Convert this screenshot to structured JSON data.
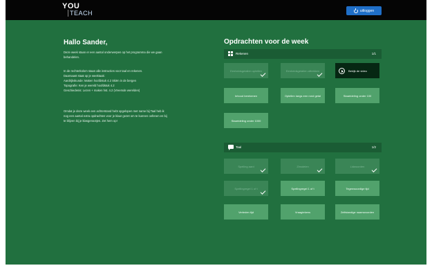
{
  "header": {
    "logo_line1": "YOU",
    "logo_line2": "TEACH",
    "logout_label": "uitloggen"
  },
  "intro": {
    "greeting": "Hallo Sander,",
    "paragraph1": [
      "Deze week staan er een aantal onderwerpen op het programma die we gaan",
      "behandelen."
    ],
    "paragraph2": [
      "In de rechterkolom staan alle instructies voor taal en rekenen.",
      "Daarnaast staat op je weektaak:",
      "Aardrijkskunde: Maken hoofdstuk 4.2 Skiën in de bergen",
      "Topografie: Ken je wereld hoofdstuk 4.2",
      "Geschiedenis: Lezen + maken hst. 4.2 (Vreemde werelden)"
    ],
    "paragraph3": [
      "Omdat je deze week een achterstand hebt opgelopen met name bij Taal heb ik",
      "nog een aantal extra opdrachten voor je klaar gezet om te kunnen oefenen en bij",
      "te blijven bij je klasgenootjes. Zet hem op!"
    ]
  },
  "assignments": {
    "title": "Opdrachten voor de week",
    "rekenen": {
      "name": "Rekenen",
      "count": "1/1",
      "tiles": [
        {
          "label": "Eenheidsgetallen optellen",
          "state": "done"
        },
        {
          "label": "Eenheidsgetallen aftrekken",
          "state": "done"
        },
        {
          "label": "Bekijk de video",
          "state": "video"
        },
        {
          "label": "Inhoud berekenen",
          "state": "todo"
        },
        {
          "label": "Optellen langs een rond getal",
          "state": "todo"
        },
        {
          "label": "Staartdeling onder 100",
          "state": "todo"
        },
        {
          "label": "Staartdeling onder 1000",
          "state": "todo"
        }
      ]
    },
    "taal": {
      "name": "Taal",
      "count": "1/2",
      "tiles": [
        {
          "label": "Spelling aard",
          "state": "done"
        },
        {
          "label": "Zinsdelen",
          "state": "done"
        },
        {
          "label": "Lidwoorden",
          "state": "done"
        },
        {
          "label": "Spellingregel 1 of t",
          "state": "done"
        },
        {
          "label": "Spellingregel 1 of t",
          "state": "todo"
        },
        {
          "label": "Tegenwoordige tijd",
          "state": "todo"
        },
        {
          "label": "Verleden tijd",
          "state": "todo"
        },
        {
          "label": "Vraagtekens",
          "state": "todo"
        },
        {
          "label": "Zelfstandige naamwoorden",
          "state": "todo"
        }
      ]
    }
  }
}
